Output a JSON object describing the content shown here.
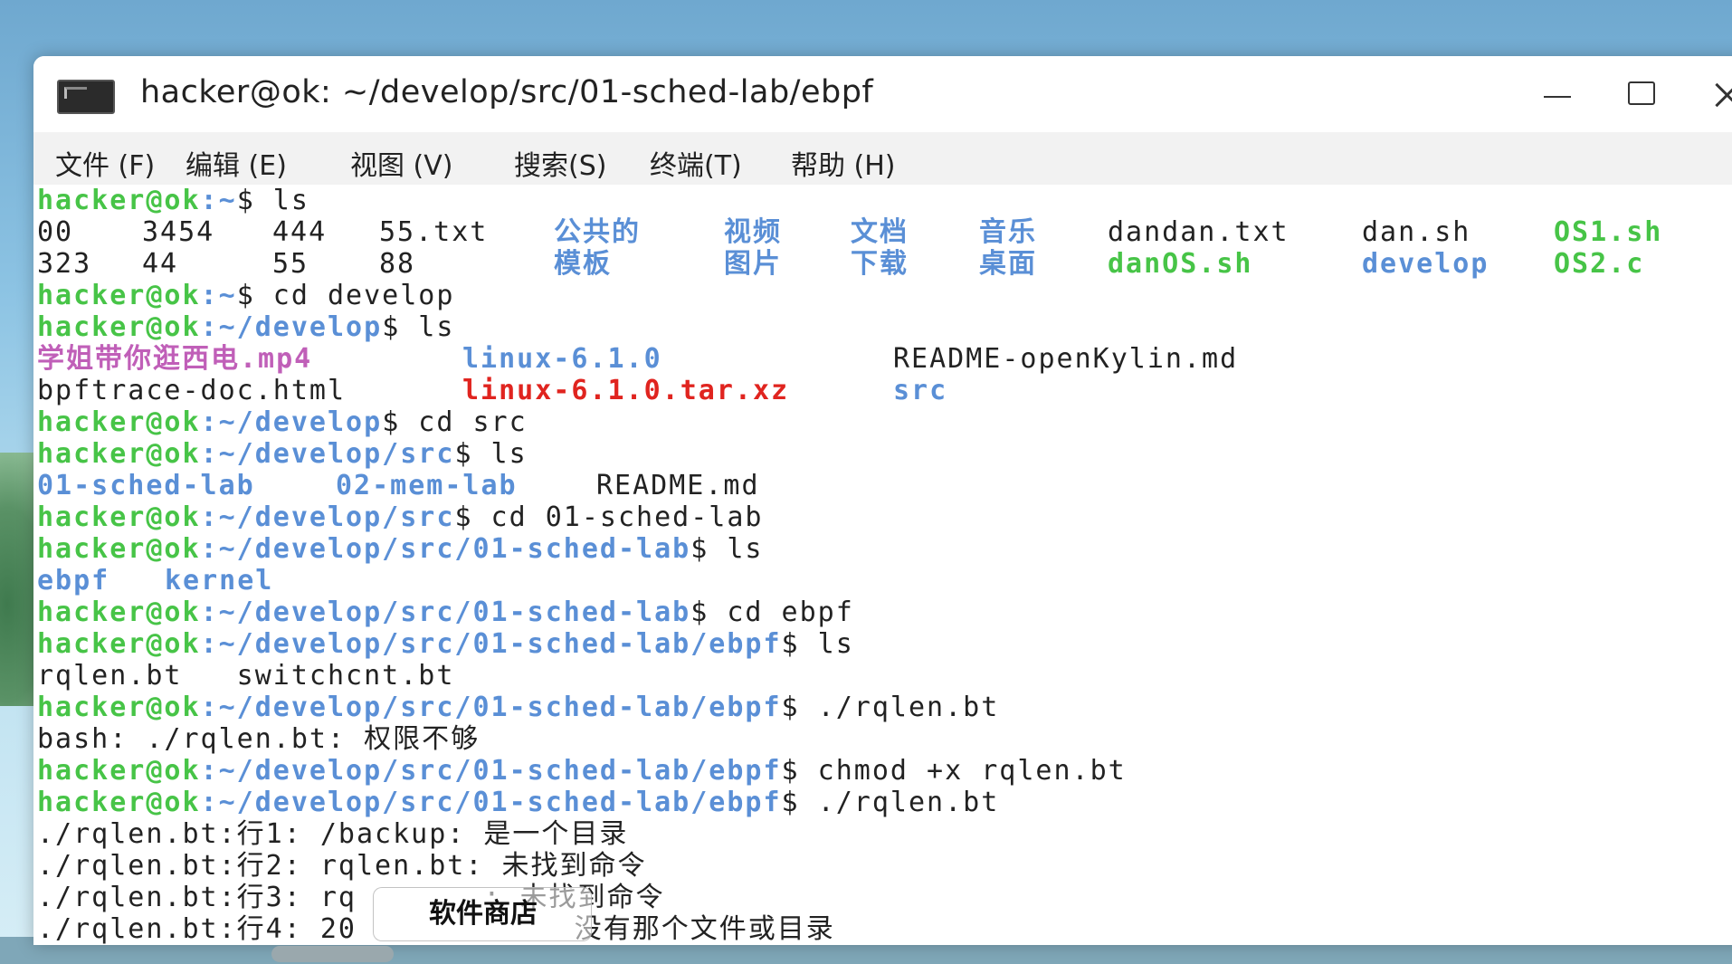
{
  "window": {
    "title": "hacker@ok: ~/develop/src/01-sched-lab/ebpf"
  },
  "menu": [
    {
      "label": "文件 (F)"
    },
    {
      "label": "编辑 (E)"
    },
    {
      "label": "视图 (V)"
    },
    {
      "label": "搜索(S)"
    },
    {
      "label": "终端(T)"
    },
    {
      "label": "帮助 (H)"
    }
  ],
  "terminal": {
    "prompt_user": "hacker@ok",
    "lines": [
      {
        "path": ":~",
        "cmd": "$ ls"
      },
      {
        "ls1": [
          "00",
          "3454",
          "444",
          "55.txt",
          "公共的",
          "视频",
          "文档",
          "音乐",
          "dandan.txt",
          "dan.sh",
          "OS1.sh"
        ]
      },
      {
        "ls2": [
          "323",
          "44",
          "55",
          "88",
          "模板",
          "图片",
          "下载",
          "桌面",
          "danOS.sh",
          "develop",
          "OS2.c"
        ]
      },
      {
        "path": ":~",
        "cmd": "$ cd develop"
      },
      {
        "path": ":~/develop",
        "cmd": "$ ls"
      },
      {
        "ls3": [
          "学姐带你逛西电.mp4",
          "linux-6.1.0",
          "README-openKylin.md"
        ]
      },
      {
        "ls4": [
          "bpftrace-doc.html",
          "linux-6.1.0.tar.xz",
          "src"
        ]
      },
      {
        "path": ":~/develop",
        "cmd": "$ cd src"
      },
      {
        "path": ":~/develop/src",
        "cmd": "$ ls"
      },
      {
        "ls5": [
          "01-sched-lab",
          "02-mem-lab",
          "README.md"
        ]
      },
      {
        "path": ":~/develop/src",
        "cmd": "$ cd 01-sched-lab"
      },
      {
        "path": ":~/develop/src/01-sched-lab",
        "cmd": "$ ls"
      },
      {
        "ls6": [
          "ebpf",
          "kernel"
        ]
      },
      {
        "path": ":~/develop/src/01-sched-lab",
        "cmd": "$ cd ebpf"
      },
      {
        "path": ":~/develop/src/01-sched-lab/ebpf",
        "cmd": "$ ls"
      },
      {
        "text": "rqlen.bt   switchcnt.bt"
      },
      {
        "path": ":~/develop/src/01-sched-lab/ebpf",
        "cmd": "$ ./rqlen.bt"
      },
      {
        "text": "bash: ./rqlen.bt: 权限不够"
      },
      {
        "path": ":~/develop/src/01-sched-lab/ebpf",
        "cmd": "$ chmod +x rqlen.bt"
      },
      {
        "path": ":~/develop/src/01-sched-lab/ebpf",
        "cmd": "$ ./rqlen.bt"
      },
      {
        "text": "./rqlen.bt:行1: /backup: 是一个目录"
      },
      {
        "text": "./rqlen.bt:行2: rqlen.bt: 未找到命令"
      },
      {
        "text": "./rqlen.bt:行3: rq       : 未找到命令"
      },
      {
        "text": "./rqlen.bt:行4: 20            没有那个文件或目录"
      }
    ]
  },
  "tooltip": {
    "label": "软件商店"
  }
}
